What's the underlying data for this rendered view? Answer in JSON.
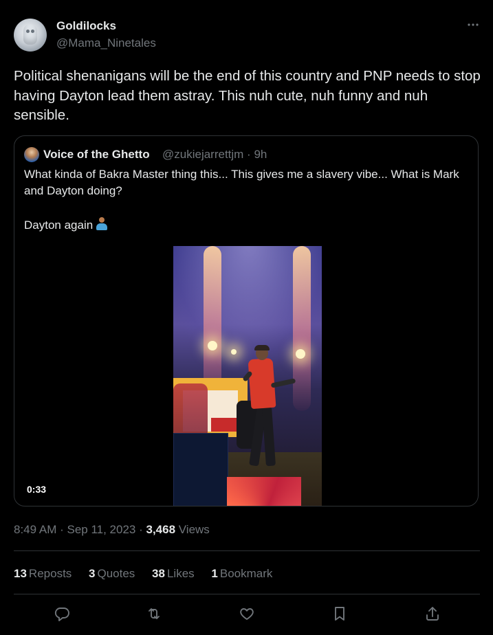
{
  "author": {
    "display_name": "Goldilocks",
    "handle": "@Mama_Ninetales",
    "avatar_icon": "owl-avatar"
  },
  "more_icon": "more-horizontal-icon",
  "post_text": "Political shenanigans will be the end of this country and PNP needs to stop having Dayton lead them astray. This nuh cute, nuh funny and nuh sensible.",
  "quoted": {
    "display_name": "Voice of the Ghetto",
    "meta": "@zukiejarrettjm · 9h",
    "text_line": "What kinda of Bakra Master thing this... This gives me a slavery vibe... What is Mark and Dayton doing?",
    "text_line2": "Dayton again",
    "emoji_icon": "person-shrugging-emoji",
    "video_duration": "0:33"
  },
  "timestamp": {
    "time_date": "8:49 AM · Sep 11, 2023 · ",
    "views_count": "3,468",
    "views_label": " Views"
  },
  "stats": {
    "reposts_count": "13",
    "reposts_label": "Reposts",
    "quotes_count": "3",
    "quotes_label": "Quotes",
    "likes_count": "38",
    "likes_label": "Likes",
    "bookmarks_count": "1",
    "bookmarks_label": "Bookmark"
  },
  "actions": [
    "reply-icon",
    "repost-icon",
    "like-icon",
    "bookmark-icon",
    "share-icon"
  ],
  "colors": {
    "background": "#000000",
    "text": "#e7e9ea",
    "secondary": "#71767b",
    "border": "#2f3336"
  }
}
